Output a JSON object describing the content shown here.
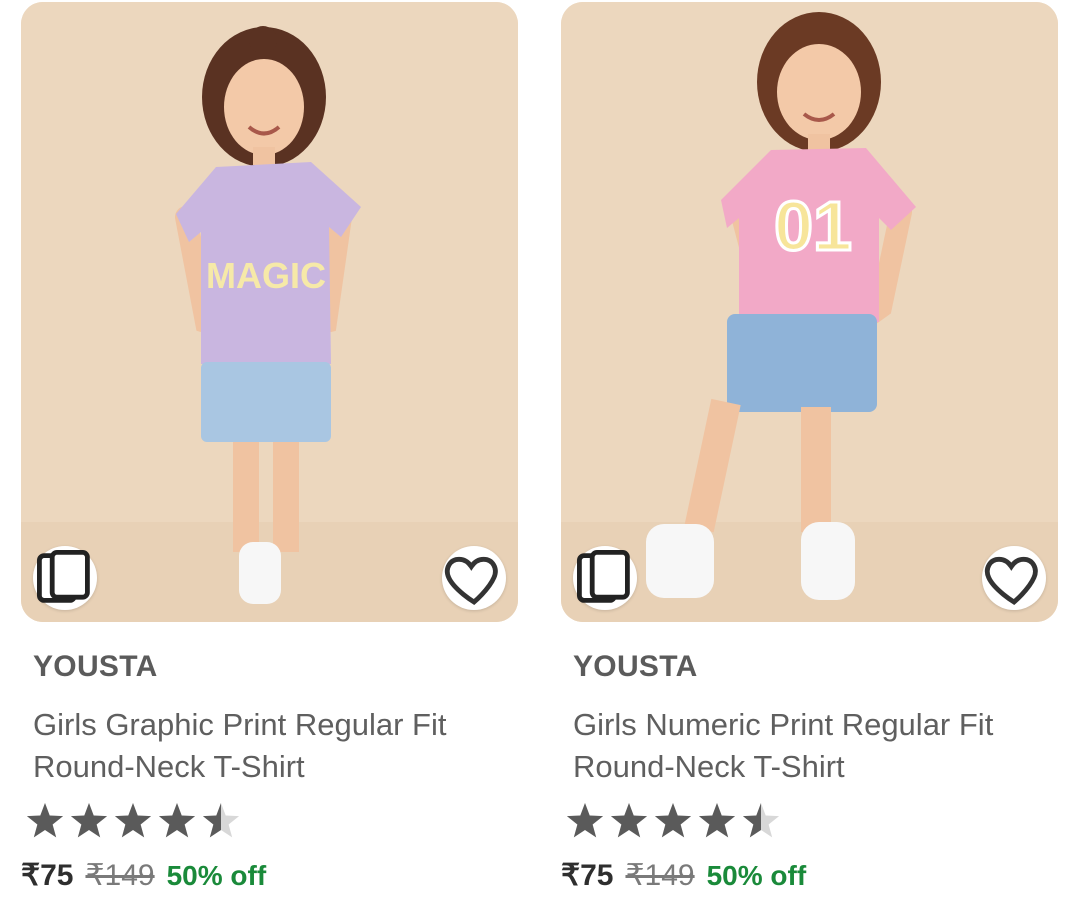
{
  "products": [
    {
      "brand": "YOUSTA",
      "title": "Girls Graphic Print Regular Fit Round-Neck T-Shirt",
      "rating": 4.5,
      "price": "₹75",
      "mrp": "₹149",
      "discount": "50% off",
      "tshirt_color": "#c9b6e0",
      "print_text": "MAGIC",
      "similar_icon": "cards-icon",
      "wishlist_icon": "heart-outline-icon"
    },
    {
      "brand": "YOUSTA",
      "title": "Girls Numeric Print Regular Fit Round-Neck T-Shirt",
      "rating": 4.5,
      "price": "₹75",
      "mrp": "₹149",
      "discount": "50% off",
      "tshirt_color": "#f2a9c7",
      "print_text": "01",
      "similar_icon": "cards-icon",
      "wishlist_icon": "heart-outline-icon"
    }
  ],
  "colors": {
    "background": "#ecd7be",
    "star_filled": "#5a5a5a",
    "star_empty": "#d8d8d8",
    "discount": "#1a8a3a",
    "shorts": "#a9c6e2"
  }
}
